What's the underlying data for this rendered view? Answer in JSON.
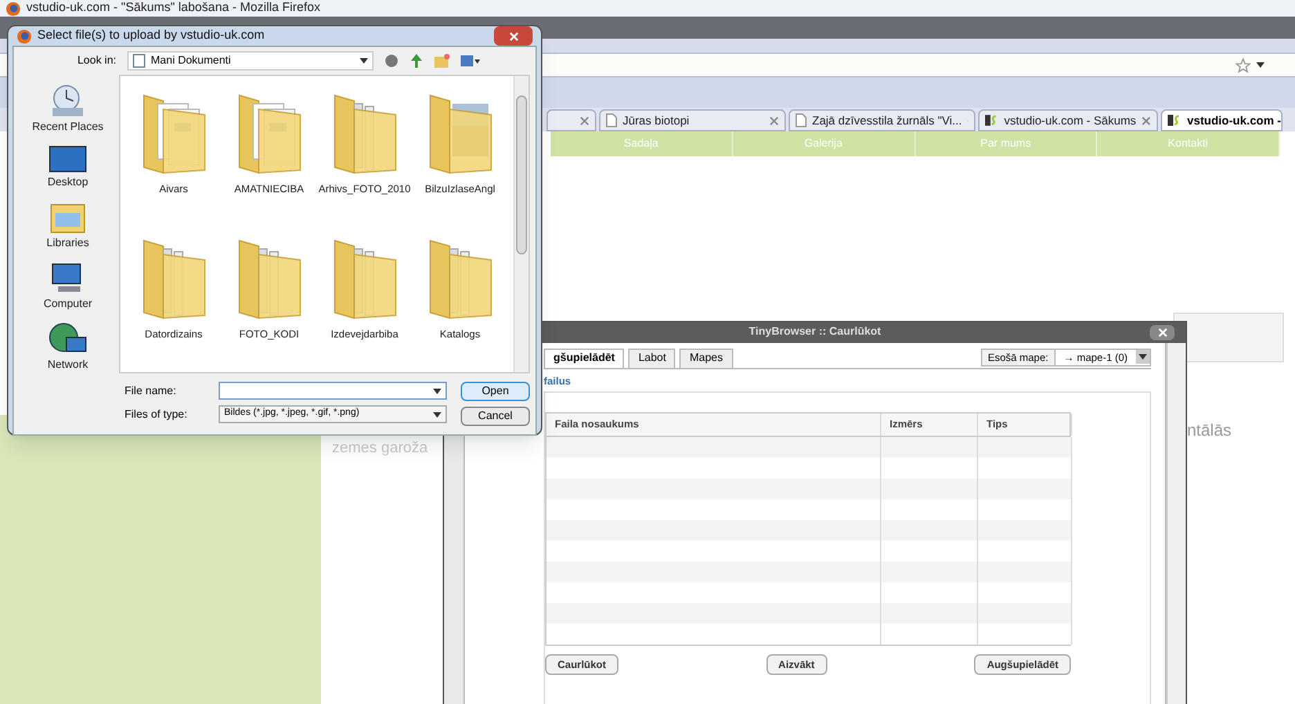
{
  "browser": {
    "title": "vstudio-uk.com - \"Sākums\" labošana - Mozilla Firefox",
    "tabs": [
      {
        "kind": "partial",
        "selected": false
      },
      {
        "kind": "page",
        "label": "Jūras biotopi",
        "selected": false
      },
      {
        "kind": "page",
        "label": "Zajā dzīvesstila žurnāls \"Vi...",
        "selected": false
      },
      {
        "kind": "site",
        "label": "vstudio-uk.com - Sākums",
        "selected": false
      },
      {
        "kind": "site",
        "label": "vstudio-uk.com -",
        "selected": true
      }
    ],
    "nav": [
      "Sadaļa",
      "Galerija",
      "Par mums",
      "Kontakti"
    ],
    "page_text_left": "zemes garoža",
    "page_text_right": "ntālās"
  },
  "tinybrowser": {
    "title": "TinyBrowser :: Caurlūkot",
    "tabs": [
      {
        "label": "gšupielādēt",
        "selected": true
      },
      {
        "label": "Labot",
        "selected": false
      },
      {
        "label": "Mapes",
        "selected": false
      }
    ],
    "folder_label": "Esošā mape:",
    "folder_value": "→ mape-1 (0)",
    "legend": "failus",
    "columns": [
      "Faila nosaukums",
      "Izmērs",
      "Tips"
    ],
    "buttons": [
      "Caurlūkot",
      "Aizvākt",
      "Augšupielādēt"
    ]
  },
  "file_dialog": {
    "title": "Select file(s) to upload by vstudio-uk.com",
    "look_in_label": "Look in:",
    "look_in_value": "Mani Dokumenti",
    "places": [
      {
        "kind": "recent",
        "label": "Recent Places"
      },
      {
        "kind": "desktop",
        "label": "Desktop"
      },
      {
        "kind": "libraries",
        "label": "Libraries"
      },
      {
        "kind": "computer",
        "label": "Computer"
      },
      {
        "kind": "network",
        "label": "Network"
      }
    ],
    "folders": [
      {
        "kind": "documents",
        "label": "Aivars"
      },
      {
        "kind": "documents",
        "label": "AMATNIECIBA"
      },
      {
        "kind": "plain",
        "label": "Arhivs_FOTO_2010"
      },
      {
        "kind": "photo",
        "label": "BilzuIzlaseAngl"
      },
      {
        "kind": "plain",
        "label": "Datordizains"
      },
      {
        "kind": "plain",
        "label": "FOTO_KODI"
      },
      {
        "kind": "plain",
        "label": "Izdevejdarbiba"
      },
      {
        "kind": "plain",
        "label": "Katalogs"
      }
    ],
    "file_name_label": "File name:",
    "files_of_type_label": "Files of type:",
    "files_of_type_value": "Bildes (*.jpg, *.jpeg, *.gif, *.png)",
    "buttons": [
      {
        "label": "Open",
        "default": true
      },
      {
        "label": "Cancel",
        "default": false
      }
    ]
  }
}
